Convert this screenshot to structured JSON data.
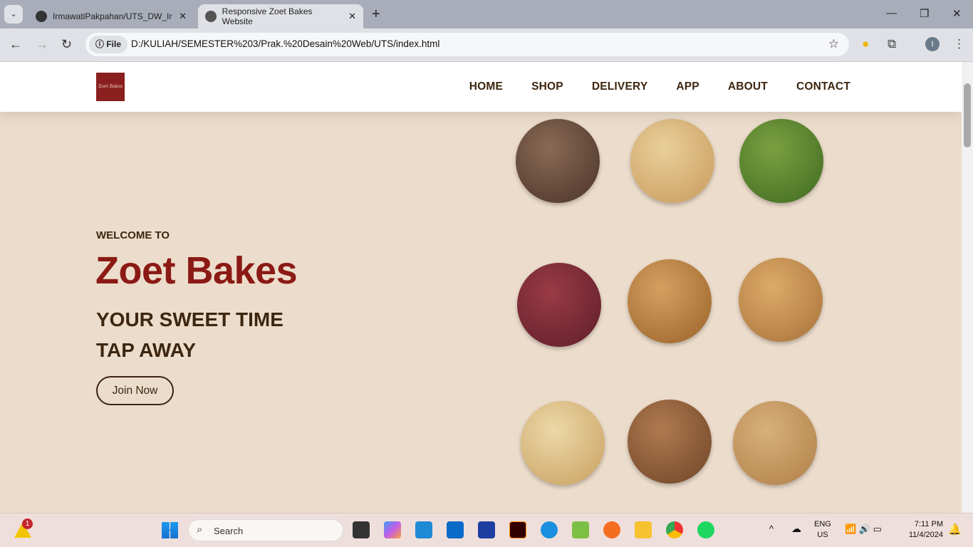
{
  "browser": {
    "tabs": [
      {
        "title": "IrmawatiPakpahan/UTS_DW_Irm",
        "icon": "github-icon"
      },
      {
        "title": "Responsive Zoet Bakes Website",
        "icon": "globe-icon"
      }
    ],
    "chip": "File",
    "url": "D:/KULIAH/SEMESTER%203/Prak.%20Desain%20Web/UTS/index.html",
    "profile": "I"
  },
  "site": {
    "logo_text": "Zoet Bakes",
    "menu": [
      "HOME",
      "SHOP",
      "DELIVERY",
      "APP",
      "ABOUT",
      "CONTACT"
    ],
    "hero": {
      "welcome": "WELCOME TO",
      "title": "Zoet Bakes",
      "tagline1": "YOUR SWEET TIME",
      "tagline2": "TAP AWAY",
      "cta": "Join Now"
    },
    "cookies": [
      "oreo",
      "cashew",
      "matcha",
      "red-velvet",
      "biscoff",
      "cheese",
      "almond",
      "chocolate",
      "pine-nut"
    ]
  },
  "taskbar": {
    "search": "Search",
    "weather_badge": "1",
    "lang": "ENG",
    "region": "US",
    "time": "7:11 PM",
    "date": "11/4/2024"
  },
  "colors": {
    "accent": "#8b1a14",
    "text": "#3d2610",
    "bg": "#ecdccb"
  }
}
